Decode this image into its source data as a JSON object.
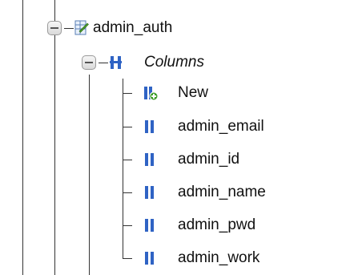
{
  "tree": {
    "table": {
      "name": "admin_auth",
      "icon": "table-structure-icon"
    },
    "columns_group": {
      "label": "Columns",
      "icon": "columns-icon"
    },
    "new_item": {
      "label": "New",
      "icon": "new-column-icon"
    },
    "columns": [
      {
        "label": "admin_email",
        "icon": "column-icon"
      },
      {
        "label": "admin_id",
        "icon": "column-icon"
      },
      {
        "label": "admin_name",
        "icon": "column-icon"
      },
      {
        "label": "admin_pwd",
        "icon": "column-icon"
      },
      {
        "label": "admin_work",
        "icon": "column-icon"
      }
    ]
  }
}
